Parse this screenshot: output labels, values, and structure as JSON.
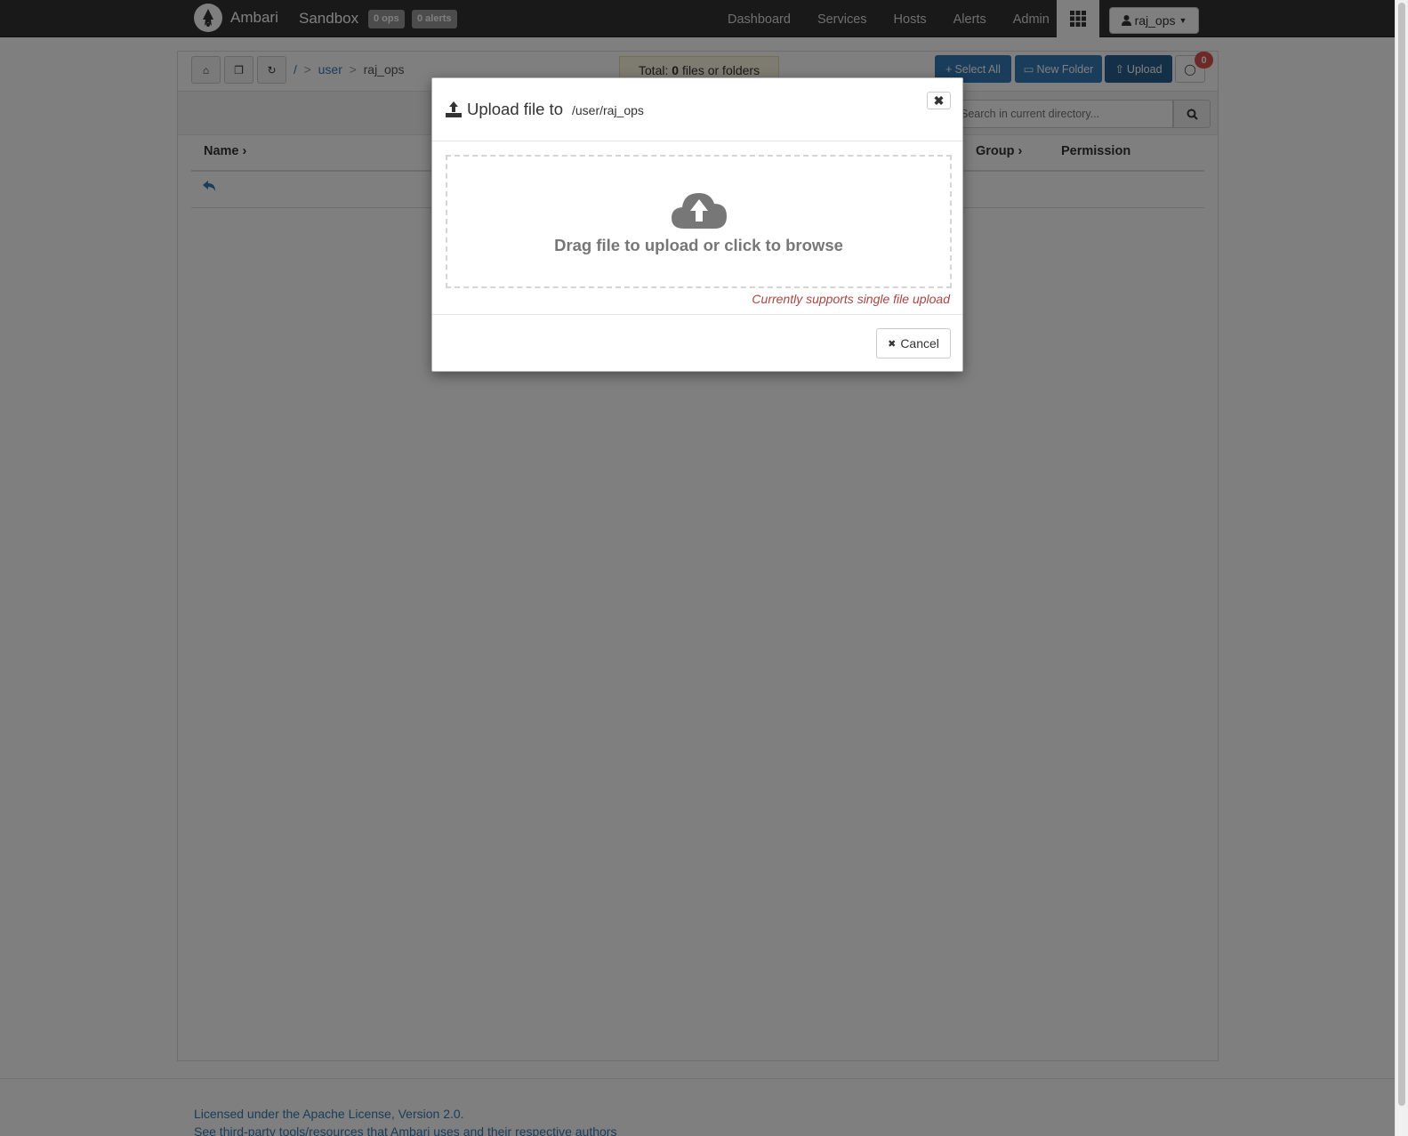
{
  "navbar": {
    "brand": "Ambari",
    "cluster": "Sandbox",
    "ops_badge": "0 ops",
    "alerts_badge": "0 alerts",
    "links": [
      "Dashboard",
      "Services",
      "Hosts",
      "Alerts",
      "Admin"
    ],
    "user": "raj_ops"
  },
  "toolbar": {
    "breadcrumb": {
      "root": "/",
      "sep": ">",
      "user": "user",
      "current": "raj_ops"
    },
    "total": {
      "prefix": "Total: ",
      "count": "0",
      "suffix": " files or folders"
    },
    "select_all": "Select All",
    "new_folder": "New Folder",
    "upload": "Upload",
    "messages_count": "0",
    "search_placeholder": "Search in current directory..."
  },
  "table": {
    "headers": {
      "name": "Name",
      "group": "Group",
      "permission": "Permission"
    }
  },
  "modal": {
    "title": "Upload file to",
    "path": "/user/raj_ops",
    "drop_text": "Drag file to upload or click to browse",
    "note": "Currently supports single file upload",
    "cancel": "Cancel"
  },
  "footer": {
    "license": "Licensed under the Apache License, Version 2.0.",
    "third_party": "See third-party tools/resources that Ambari uses and their respective authors"
  },
  "colors": {
    "navbar": "#333333",
    "primary": "#337ab7",
    "danger_text": "#a94442",
    "badge": "#d9534f"
  }
}
